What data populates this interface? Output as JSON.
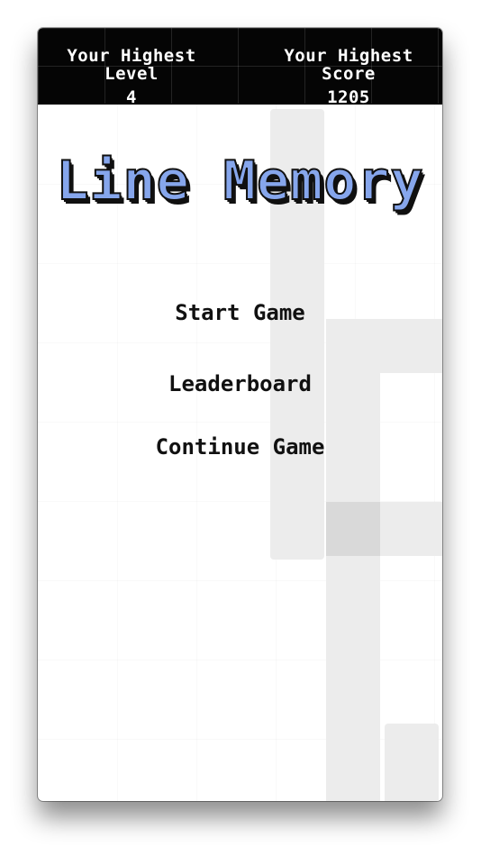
{
  "hud": {
    "highest_level_label": "Your Highest Level",
    "highest_level_value": "4",
    "highest_score_label": "Your Highest Score",
    "highest_score_value": "1205"
  },
  "game": {
    "title": "Line Memory"
  },
  "menu": {
    "start": "Start Game",
    "leaderboard": "Leaderboard",
    "continue": "Continue Game"
  },
  "colors": {
    "title_fill": "#86a6ec",
    "title_outline": "#101010",
    "hud_background": "#050505",
    "background_line": "#ececec"
  }
}
